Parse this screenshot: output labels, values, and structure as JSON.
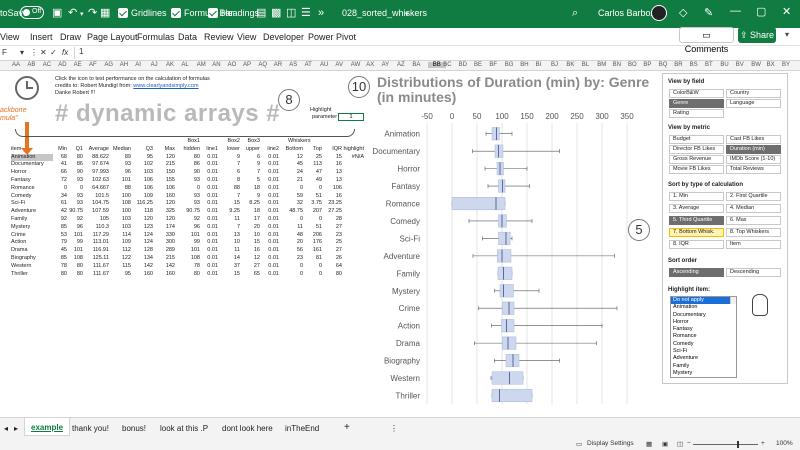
{
  "titlebar": {
    "autosave": "toSave",
    "toggle": "Off",
    "options": [
      "Gridlines",
      "Formula Bar",
      "Headings"
    ],
    "filename": "028_sorted_whiskers",
    "user": "Carlos Barboza"
  },
  "ribbon": {
    "tabs": [
      "View",
      "Insert",
      "Draw",
      "Page Layout",
      "Formulas",
      "Data",
      "Review",
      "View",
      "Developer",
      "Power Pivot"
    ],
    "comments": "Comments",
    "share": "Share"
  },
  "formula_bar": {
    "name_box": "F",
    "fx": "fx",
    "value": "1"
  },
  "columns": [
    "AA",
    "AB",
    "AC",
    "AD",
    "AE",
    "AF",
    "AG",
    "AH",
    "AI",
    "AJ",
    "AK",
    "AL",
    "AM",
    "AN",
    "AO",
    "AP",
    "AQ",
    "AR",
    "AS",
    "AT",
    "AU",
    "AV",
    "AW",
    "AX",
    "AY",
    "AZ",
    "BA",
    "BB",
    "BC",
    "BD",
    "BE",
    "BF",
    "BG",
    "BH",
    "BI",
    "BJ",
    "BK",
    "BL",
    "BM",
    "BN",
    "BO",
    "BP",
    "BQ",
    "BR",
    "BS",
    "BT",
    "BU",
    "BV",
    "BW",
    "BX",
    "BY"
  ],
  "sheet": {
    "notes": [
      "Click the icon to test performance on the calculation of formulas",
      "credits to: Robert Mundigl from:",
      "Danke Robert !!!"
    ],
    "link": "www.clearlyandsimply.com",
    "orange_tag": "ackbone\nmula\"",
    "big_title": "# dynamic arrays #",
    "badge8": "8",
    "badge10": "10",
    "badge5": "5",
    "highlight_label1": "Highlight",
    "highlight_label2": "parameter",
    "highlight_value": "1",
    "whiskers_label": "Whiskers"
  },
  "table": {
    "header1": [
      "",
      "",
      "",
      "",
      "",
      "",
      "",
      "Box1",
      "",
      "Box2",
      "Box3",
      "",
      "",
      "",
      "",
      ""
    ],
    "header2": [
      "item",
      "Min",
      "Q1",
      "Average",
      "Median",
      "Q3",
      "Max",
      "hidden",
      "line1",
      "lower",
      "upper",
      "line2",
      "Bottom",
      "Top",
      "IQR",
      "highlight"
    ],
    "rows": [
      [
        "Animation",
        "68",
        "80",
        "88.622",
        "89",
        "95",
        "120",
        "80",
        "0.01",
        "9",
        "6",
        "0.01",
        "12",
        "25",
        "15",
        "#N/A"
      ],
      [
        "Documentary",
        "41",
        "86",
        "97.674",
        "93",
        "102",
        "215",
        "86",
        "0.01",
        "7",
        "9",
        "0.01",
        "45",
        "113",
        "16",
        ""
      ],
      [
        "Horror",
        "66",
        "90",
        "97.993",
        "96",
        "103",
        "150",
        "90",
        "0.01",
        "6",
        "7",
        "0.01",
        "24",
        "47",
        "13",
        ""
      ],
      [
        "Fantasy",
        "72",
        "93",
        "102.63",
        "101",
        "106",
        "155",
        "93",
        "0.01",
        "8",
        "5",
        "0.01",
        "21",
        "49",
        "13",
        ""
      ],
      [
        "Romance",
        "0",
        "0",
        "64.667",
        "88",
        "106",
        "106",
        "0",
        "0.01",
        "88",
        "18",
        "0.01",
        "0",
        "0",
        "106",
        ""
      ],
      [
        "Comedy",
        "34",
        "93",
        "101.5",
        "100",
        "109",
        "160",
        "93",
        "0.01",
        "7",
        "9",
        "0.01",
        "59",
        "51",
        "16",
        ""
      ],
      [
        "Sci-Fi",
        "61",
        "93",
        "104.75",
        "108",
        "116.25",
        "120",
        "93",
        "0.01",
        "15",
        "8.25",
        "0.01",
        "32",
        "3.75",
        "23.25",
        ""
      ],
      [
        "Adventure",
        "42",
        "90.75",
        "107.59",
        "100",
        "118",
        "325",
        "90.75",
        "0.01",
        "9.25",
        "18",
        "0.01",
        "48.75",
        "207",
        "27.25",
        ""
      ],
      [
        "Family",
        "92",
        "92",
        "105",
        "103",
        "120",
        "120",
        "92",
        "0.01",
        "11",
        "17",
        "0.01",
        "0",
        "0",
        "28",
        ""
      ],
      [
        "Mystery",
        "85",
        "96",
        "110.3",
        "103",
        "123",
        "174",
        "96",
        "0.01",
        "7",
        "20",
        "0.01",
        "11",
        "51",
        "27",
        ""
      ],
      [
        "Crime",
        "53",
        "101",
        "117.29",
        "114",
        "124",
        "330",
        "101",
        "0.01",
        "13",
        "10",
        "0.01",
        "48",
        "206",
        "23",
        ""
      ],
      [
        "Action",
        "79",
        "99",
        "113.01",
        "109",
        "124",
        "300",
        "99",
        "0.01",
        "10",
        "15",
        "0.01",
        "20",
        "176",
        "25",
        ""
      ],
      [
        "Drama",
        "45",
        "101",
        "116.91",
        "112",
        "128",
        "289",
        "101",
        "0.01",
        "11",
        "16",
        "0.01",
        "56",
        "161",
        "27",
        ""
      ],
      [
        "Biography",
        "85",
        "108",
        "125.11",
        "122",
        "134",
        "215",
        "108",
        "0.01",
        "14",
        "12",
        "0.01",
        "23",
        "81",
        "26",
        ""
      ],
      [
        "Western",
        "78",
        "80",
        "111.67",
        "115",
        "142",
        "142",
        "78",
        "0.01",
        "37",
        "27",
        "0.01",
        "0",
        "0",
        "64",
        ""
      ],
      [
        "Thriller",
        "80",
        "80",
        "111.67",
        "95",
        "160",
        "160",
        "80",
        "0.01",
        "15",
        "65",
        "0.01",
        "0",
        "0",
        "80",
        ""
      ]
    ]
  },
  "chart_data": {
    "type": "bar",
    "title": "Distributions of Duration (min) by: Genre (in minutes)",
    "xlabel": "",
    "ylabel": "",
    "xlim": [
      -50,
      350
    ],
    "xticks": [
      "-50",
      "0",
      "50",
      "100",
      "150",
      "200",
      "250",
      "300",
      "350"
    ],
    "xtick_values": [
      -50,
      0,
      50,
      100,
      150,
      200,
      250,
      300,
      350
    ],
    "categories": [
      "Animation",
      "Documentary",
      "Horror",
      "Fantasy",
      "Romance",
      "Comedy",
      "Sci-Fi",
      "Adventure",
      "Family",
      "Mystery",
      "Crime",
      "Action",
      "Drama",
      "Biography",
      "Western",
      "Thriller"
    ],
    "series": [
      {
        "values_min": [
          68,
          41,
          66,
          72,
          0,
          34,
          61,
          42,
          92,
          85,
          53,
          79,
          45,
          85,
          78,
          80
        ]
      },
      {
        "values_q1": [
          80,
          86,
          90,
          93,
          0,
          93,
          93,
          90.75,
          92,
          96,
          101,
          99,
          101,
          108,
          80,
          80
        ]
      },
      {
        "values_median": [
          89,
          93,
          96,
          101,
          88,
          100,
          108,
          100,
          103,
          103,
          114,
          109,
          112,
          122,
          115,
          95
        ]
      },
      {
        "values_q3": [
          95,
          102,
          103,
          106,
          106,
          109,
          116.25,
          118,
          120,
          123,
          124,
          124,
          128,
          134,
          142,
          160
        ]
      },
      {
        "values_max": [
          120,
          215,
          150,
          155,
          106,
          160,
          120,
          325,
          120,
          174,
          330,
          300,
          289,
          215,
          142,
          160
        ]
      }
    ],
    "colors": {
      "box_fill": "#cdd7ee",
      "box_stroke": "#a9b8dd",
      "median_line": "#3a4f8a",
      "whisker": "#555555",
      "grid": "#d9d9d9"
    },
    "grid": true,
    "legend": "none"
  },
  "panel": {
    "view_by_field": "View by field",
    "field_buttons": [
      "ColorB&W",
      "Country",
      "Genre",
      "Language",
      "Rating"
    ],
    "view_by_metric": "View by metric",
    "metric_buttons": [
      "Budget",
      "Cast FB Likes",
      "Director FB Likes",
      "Duration (min)",
      "Gross Revenue",
      "IMDb Score (1-10)",
      "Movie FB Likes",
      "Total Reviews"
    ],
    "sort_by": "Sort by type of calculation",
    "sort_buttons": [
      "1. Min",
      "2. First Quartile",
      "3. Average",
      "4. Median",
      "5. Third Quartile",
      "6. Max",
      "7. Bottom Whisk.",
      "8. Top Whiskers",
      "8. IQR",
      "Item"
    ],
    "sort_order": "Sort order",
    "order_buttons": [
      "Ascending",
      "Descending"
    ],
    "highlight_item": "Highlight item:",
    "highlight_list": [
      "Do not apply",
      "Animation",
      "Documentary",
      "Horror",
      "Fantasy",
      "Romance",
      "Comedy",
      "Sci-Fi",
      "Adventure",
      "Family",
      "Mystery"
    ]
  },
  "sheet_tabs": [
    "example",
    "thank you!",
    "bonus!",
    "look at this .P",
    "dont look here",
    "inTheEnd"
  ],
  "statusbar": {
    "display": "Display Settings",
    "zoom": "100%"
  }
}
